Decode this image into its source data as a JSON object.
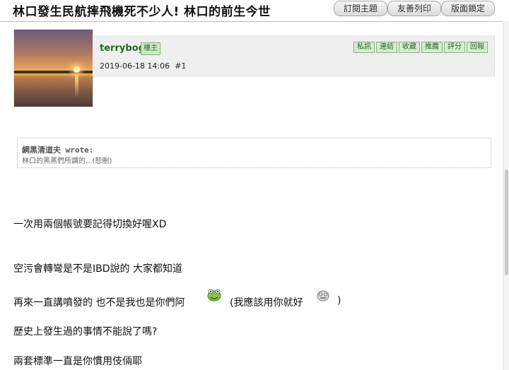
{
  "header": {
    "title": "林口發生民航摔飛機死不少人! 林口的前生今世",
    "buttons": [
      "訂閱主題",
      "友善列印",
      "版面鎖定"
    ]
  },
  "post": {
    "username": "terrybog",
    "badge": "樓主",
    "timestamp": "2019-06-18 14:06",
    "floor": "#1",
    "actions": [
      "私訊",
      "連結",
      "收藏",
      "推薦",
      "評分",
      "回報"
    ]
  },
  "quote": {
    "author": "網黑清道夫 wrote:",
    "text": "林口的黑黑們所謂的...(恕刪)"
  },
  "body": {
    "line1": "一次用兩個帳號要記得切換好喔XD",
    "line2": "空污會轉彎是不是IBD說的 大家都知道",
    "line3a": "再來一直講噴發的 也不是我也是你們阿",
    "line3b": "(我應該用你就好",
    "line3c": ")",
    "line4": "歷史上發生過的事情不能說了嗎?",
    "line5": "兩套標準一直是你慣用伎倆耶"
  }
}
